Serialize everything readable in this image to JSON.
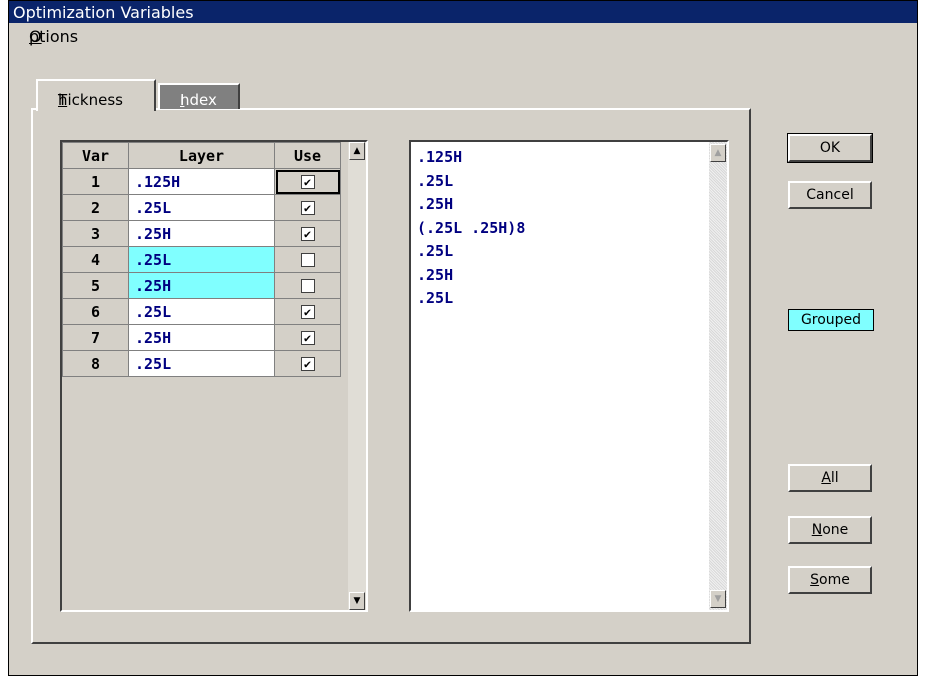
{
  "window": {
    "title": "Optimization Variables"
  },
  "menu": {
    "options_prefix": "O",
    "options_rest": "ptions"
  },
  "tabs": [
    {
      "prefix": "T",
      "rest": "hickness",
      "active": true
    },
    {
      "prefix": "I",
      "rest": "ndex",
      "active": false
    }
  ],
  "grid": {
    "headers": [
      "Var",
      "Layer",
      "Use"
    ],
    "rows": [
      {
        "var": "1",
        "layer": ".125H",
        "use": true,
        "highlight": false
      },
      {
        "var": "2",
        "layer": ".25L",
        "use": true,
        "highlight": false
      },
      {
        "var": "3",
        "layer": ".25H",
        "use": true,
        "highlight": false
      },
      {
        "var": "4",
        "layer": ".25L",
        "use": false,
        "highlight": true
      },
      {
        "var": "5",
        "layer": ".25H",
        "use": false,
        "highlight": true
      },
      {
        "var": "6",
        "layer": ".25L",
        "use": true,
        "highlight": false
      },
      {
        "var": "7",
        "layer": ".25H",
        "use": true,
        "highlight": false
      },
      {
        "var": "8",
        "layer": ".25L",
        "use": true,
        "highlight": false
      }
    ]
  },
  "design_list": [
    ".125H",
    ".25L",
    ".25H",
    "(.25L .25H)8",
    ".25L",
    ".25H",
    ".25L"
  ],
  "buttons": {
    "ok": "OK",
    "cancel": "Cancel",
    "all_prefix": "A",
    "all_rest": "ll",
    "none_prefix": "N",
    "none_rest": "one",
    "some_prefix": "S",
    "some_rest": "ome"
  },
  "status": {
    "grouped": "Grouped"
  },
  "colors": {
    "title_bg": "#0a246a",
    "highlight": "#80ffff",
    "text_blue": "#000080"
  }
}
